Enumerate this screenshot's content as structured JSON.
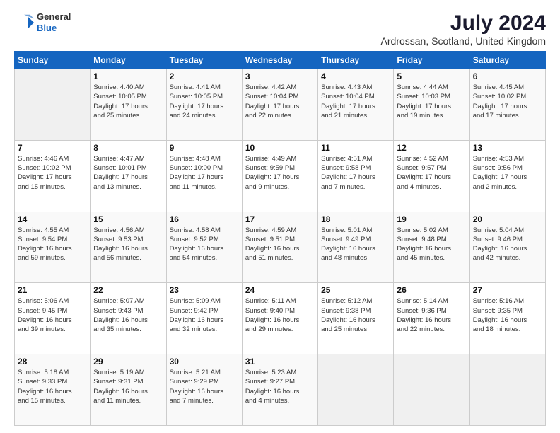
{
  "header": {
    "logo_general": "General",
    "logo_blue": "Blue",
    "title": "July 2024",
    "subtitle": "Ardrossan, Scotland, United Kingdom"
  },
  "days_of_week": [
    "Sunday",
    "Monday",
    "Tuesday",
    "Wednesday",
    "Thursday",
    "Friday",
    "Saturday"
  ],
  "weeks": [
    [
      {
        "day": "",
        "content": ""
      },
      {
        "day": "1",
        "content": "Sunrise: 4:40 AM\nSunset: 10:05 PM\nDaylight: 17 hours\nand 25 minutes."
      },
      {
        "day": "2",
        "content": "Sunrise: 4:41 AM\nSunset: 10:05 PM\nDaylight: 17 hours\nand 24 minutes."
      },
      {
        "day": "3",
        "content": "Sunrise: 4:42 AM\nSunset: 10:04 PM\nDaylight: 17 hours\nand 22 minutes."
      },
      {
        "day": "4",
        "content": "Sunrise: 4:43 AM\nSunset: 10:04 PM\nDaylight: 17 hours\nand 21 minutes."
      },
      {
        "day": "5",
        "content": "Sunrise: 4:44 AM\nSunset: 10:03 PM\nDaylight: 17 hours\nand 19 minutes."
      },
      {
        "day": "6",
        "content": "Sunrise: 4:45 AM\nSunset: 10:02 PM\nDaylight: 17 hours\nand 17 minutes."
      }
    ],
    [
      {
        "day": "7",
        "content": "Sunrise: 4:46 AM\nSunset: 10:02 PM\nDaylight: 17 hours\nand 15 minutes."
      },
      {
        "day": "8",
        "content": "Sunrise: 4:47 AM\nSunset: 10:01 PM\nDaylight: 17 hours\nand 13 minutes."
      },
      {
        "day": "9",
        "content": "Sunrise: 4:48 AM\nSunset: 10:00 PM\nDaylight: 17 hours\nand 11 minutes."
      },
      {
        "day": "10",
        "content": "Sunrise: 4:49 AM\nSunset: 9:59 PM\nDaylight: 17 hours\nand 9 minutes."
      },
      {
        "day": "11",
        "content": "Sunrise: 4:51 AM\nSunset: 9:58 PM\nDaylight: 17 hours\nand 7 minutes."
      },
      {
        "day": "12",
        "content": "Sunrise: 4:52 AM\nSunset: 9:57 PM\nDaylight: 17 hours\nand 4 minutes."
      },
      {
        "day": "13",
        "content": "Sunrise: 4:53 AM\nSunset: 9:56 PM\nDaylight: 17 hours\nand 2 minutes."
      }
    ],
    [
      {
        "day": "14",
        "content": "Sunrise: 4:55 AM\nSunset: 9:54 PM\nDaylight: 16 hours\nand 59 minutes."
      },
      {
        "day": "15",
        "content": "Sunrise: 4:56 AM\nSunset: 9:53 PM\nDaylight: 16 hours\nand 56 minutes."
      },
      {
        "day": "16",
        "content": "Sunrise: 4:58 AM\nSunset: 9:52 PM\nDaylight: 16 hours\nand 54 minutes."
      },
      {
        "day": "17",
        "content": "Sunrise: 4:59 AM\nSunset: 9:51 PM\nDaylight: 16 hours\nand 51 minutes."
      },
      {
        "day": "18",
        "content": "Sunrise: 5:01 AM\nSunset: 9:49 PM\nDaylight: 16 hours\nand 48 minutes."
      },
      {
        "day": "19",
        "content": "Sunrise: 5:02 AM\nSunset: 9:48 PM\nDaylight: 16 hours\nand 45 minutes."
      },
      {
        "day": "20",
        "content": "Sunrise: 5:04 AM\nSunset: 9:46 PM\nDaylight: 16 hours\nand 42 minutes."
      }
    ],
    [
      {
        "day": "21",
        "content": "Sunrise: 5:06 AM\nSunset: 9:45 PM\nDaylight: 16 hours\nand 39 minutes."
      },
      {
        "day": "22",
        "content": "Sunrise: 5:07 AM\nSunset: 9:43 PM\nDaylight: 16 hours\nand 35 minutes."
      },
      {
        "day": "23",
        "content": "Sunrise: 5:09 AM\nSunset: 9:42 PM\nDaylight: 16 hours\nand 32 minutes."
      },
      {
        "day": "24",
        "content": "Sunrise: 5:11 AM\nSunset: 9:40 PM\nDaylight: 16 hours\nand 29 minutes."
      },
      {
        "day": "25",
        "content": "Sunrise: 5:12 AM\nSunset: 9:38 PM\nDaylight: 16 hours\nand 25 minutes."
      },
      {
        "day": "26",
        "content": "Sunrise: 5:14 AM\nSunset: 9:36 PM\nDaylight: 16 hours\nand 22 minutes."
      },
      {
        "day": "27",
        "content": "Sunrise: 5:16 AM\nSunset: 9:35 PM\nDaylight: 16 hours\nand 18 minutes."
      }
    ],
    [
      {
        "day": "28",
        "content": "Sunrise: 5:18 AM\nSunset: 9:33 PM\nDaylight: 16 hours\nand 15 minutes."
      },
      {
        "day": "29",
        "content": "Sunrise: 5:19 AM\nSunset: 9:31 PM\nDaylight: 16 hours\nand 11 minutes."
      },
      {
        "day": "30",
        "content": "Sunrise: 5:21 AM\nSunset: 9:29 PM\nDaylight: 16 hours\nand 7 minutes."
      },
      {
        "day": "31",
        "content": "Sunrise: 5:23 AM\nSunset: 9:27 PM\nDaylight: 16 hours\nand 4 minutes."
      },
      {
        "day": "",
        "content": ""
      },
      {
        "day": "",
        "content": ""
      },
      {
        "day": "",
        "content": ""
      }
    ]
  ]
}
